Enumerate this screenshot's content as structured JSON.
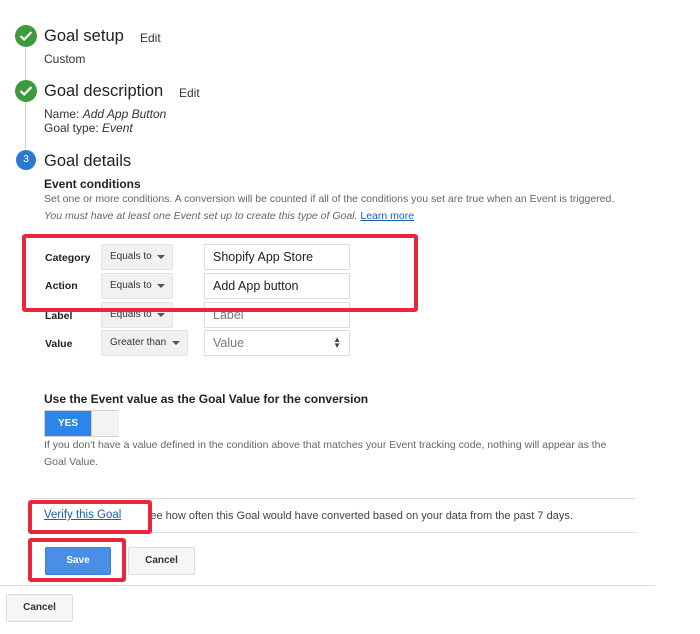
{
  "steps": {
    "setup": {
      "title": "Goal setup",
      "edit": "Edit",
      "value": "Custom"
    },
    "description": {
      "title": "Goal description",
      "edit": "Edit",
      "name_label": "Name: ",
      "name_value": "Add App Button",
      "type_label": "Goal type: ",
      "type_value": "Event"
    },
    "details": {
      "number": "3",
      "title": "Goal details",
      "conditions_heading": "Event conditions",
      "conditions_desc": "Set one or more conditions. A conversion will be counted if all of the conditions you set are true when an Event is triggered.",
      "conditions_desc_italic": "You must have at least one Event set up to create this type of Goal.",
      "learn_more": "Learn more"
    }
  },
  "conditions": [
    {
      "label": "Category",
      "operator": "Equals to",
      "value": "Shopify App Store",
      "placeholder": false
    },
    {
      "label": "Action",
      "operator": "Equals to",
      "value": "Add App button",
      "placeholder": false
    },
    {
      "label": "Label",
      "operator": "Equals to",
      "value": "Label",
      "placeholder": true
    },
    {
      "label": "Value",
      "operator": "Greater than",
      "value": "Value",
      "placeholder": true
    }
  ],
  "goal_value": {
    "heading": "Use the Event value as the Goal Value for the conversion",
    "toggle_label": "YES",
    "toggle_on": true,
    "note": "If you don't have a value defined in the condition above that matches your Event tracking code, nothing will appear as the Goal Value."
  },
  "verify": {
    "link": "Verify this Goal",
    "text": "See how often this Goal would have converted based on your data from the past 7 days."
  },
  "actions": {
    "save": "Save",
    "cancel": "Cancel",
    "outer_cancel": "Cancel"
  },
  "colors": {
    "accent": "#4a8fe7",
    "success": "#3f9a3f",
    "highlight": "#e8283a"
  }
}
